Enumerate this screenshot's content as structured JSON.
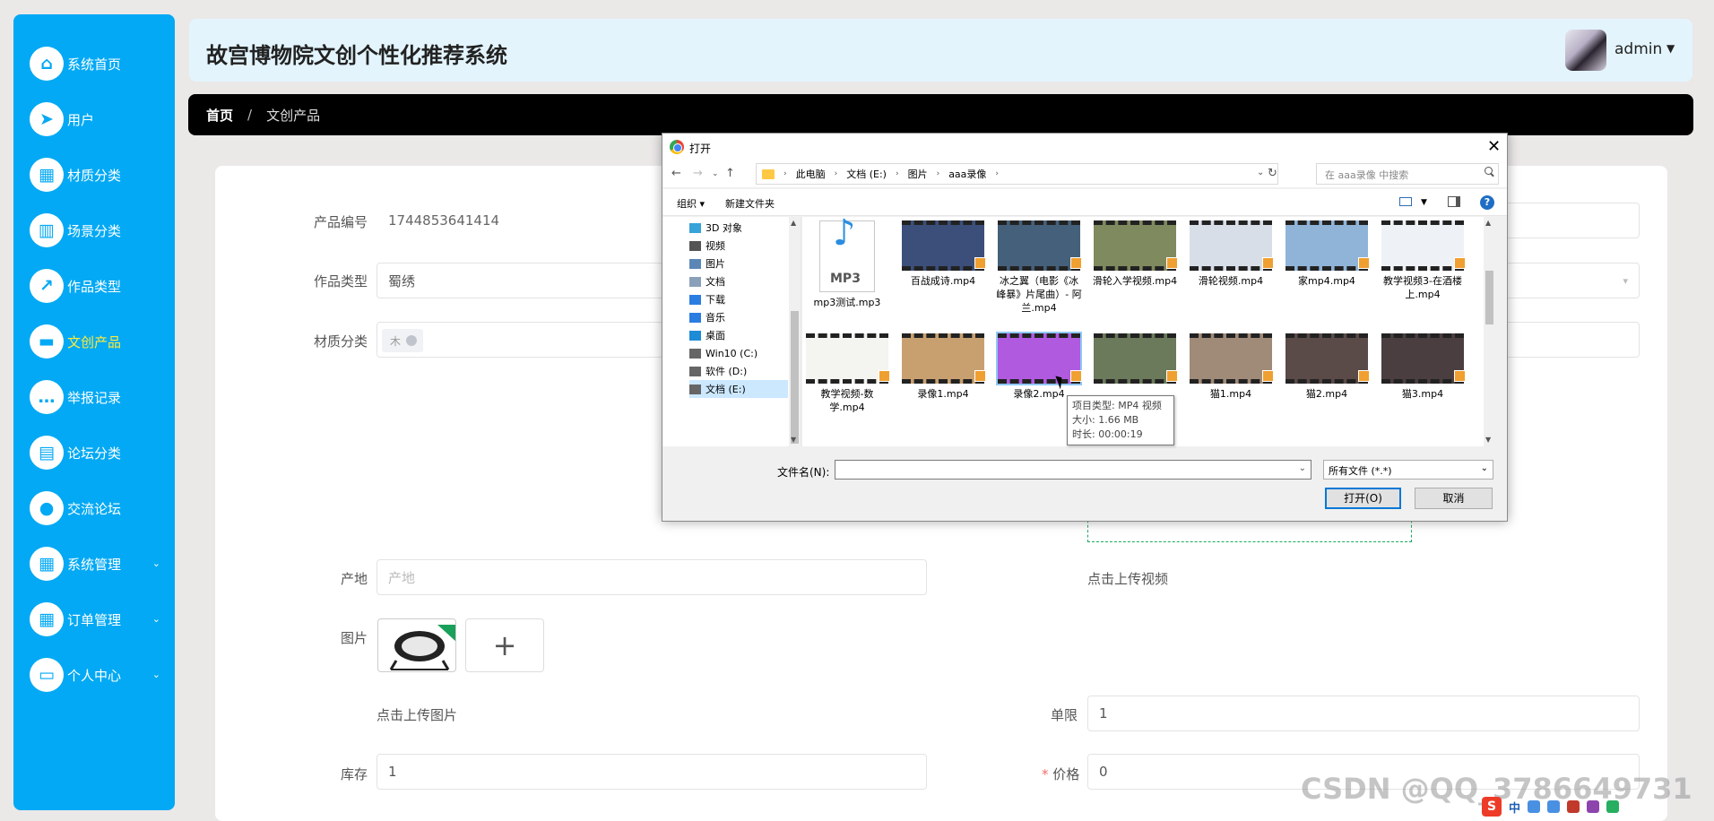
{
  "sidebar": {
    "items": [
      {
        "label": "系统首页",
        "icon": "home-icon",
        "glyph": "⌂",
        "active": false,
        "expandable": false
      },
      {
        "label": "用户",
        "icon": "send-icon",
        "glyph": "➤",
        "active": false,
        "expandable": false
      },
      {
        "label": "材质分类",
        "icon": "grid-icon",
        "glyph": "▦",
        "active": false,
        "expandable": false
      },
      {
        "label": "场景分类",
        "icon": "book-icon",
        "glyph": "▥",
        "active": false,
        "expandable": false
      },
      {
        "label": "作品类型",
        "icon": "chart-icon",
        "glyph": "↗",
        "active": false,
        "expandable": false
      },
      {
        "label": "文创产品",
        "icon": "box-icon",
        "glyph": "▬",
        "active": true,
        "expandable": false
      },
      {
        "label": "举报记录",
        "icon": "message-icon",
        "glyph": "…",
        "active": false,
        "expandable": false
      },
      {
        "label": "论坛分类",
        "icon": "briefcase-icon",
        "glyph": "▤",
        "active": false,
        "expandable": false
      },
      {
        "label": "交流论坛",
        "icon": "pin-icon",
        "glyph": "●",
        "active": false,
        "expandable": false
      },
      {
        "label": "系统管理",
        "icon": "grid-icon",
        "glyph": "▦",
        "active": false,
        "expandable": true
      },
      {
        "label": "订单管理",
        "icon": "grid-icon",
        "glyph": "▦",
        "active": false,
        "expandable": true
      },
      {
        "label": "个人中心",
        "icon": "panel-icon",
        "glyph": "▭",
        "active": false,
        "expandable": true
      }
    ]
  },
  "header": {
    "title": "故宫博物院文创个性化推荐系统",
    "user": "admin"
  },
  "breadcrumb": {
    "home": "首页",
    "sep": "/",
    "current": "文创产品"
  },
  "form": {
    "code_label": "产品编号",
    "code_value": "1744853641414",
    "type_label": "作品类型",
    "type_value": "蜀绣",
    "material_label": "材质分类",
    "material_tag": "木",
    "origin_label": "产地",
    "origin_placeholder": "产地",
    "video_hint": "点击上传视频",
    "image_label": "图片",
    "add_symbol": "+",
    "image_hint": "点击上传图片",
    "limit_label": "单限",
    "limit_value": "1",
    "stock_label": "库存",
    "stock_value": "1",
    "price_req": "*",
    "price_label": "价格",
    "price_value": "0"
  },
  "dialog": {
    "title": "打开",
    "close": "✕",
    "path": [
      "此电脑",
      "文档 (E:)",
      "图片",
      "aaa录像"
    ],
    "search_placeholder": "在 aaa录像 中搜索",
    "toolbar": {
      "organize": "组织 ▾",
      "new_folder": "新建文件夹"
    },
    "tree": [
      {
        "label": "3D 对象",
        "color": "#37a3d8",
        "selected": false
      },
      {
        "label": "视频",
        "color": "#555555",
        "selected": false
      },
      {
        "label": "图片",
        "color": "#5b87b6",
        "selected": false
      },
      {
        "label": "文档",
        "color": "#8aa0b8",
        "selected": false
      },
      {
        "label": "下载",
        "color": "#2b7de0",
        "selected": false
      },
      {
        "label": "音乐",
        "color": "#2b7de0",
        "selected": false
      },
      {
        "label": "桌面",
        "color": "#1e8bd6",
        "selected": false
      },
      {
        "label": "Win10 (C:)",
        "color": "#666666",
        "selected": false
      },
      {
        "label": "软件 (D:)",
        "color": "#666666",
        "selected": false
      },
      {
        "label": "文档 (E:)",
        "color": "#666666",
        "selected": true
      }
    ],
    "files_row1": [
      {
        "name": "mp3测试.mp3",
        "kind": "mp3",
        "color": "#ffffff"
      },
      {
        "name": "百战成诗.mp4",
        "kind": "video",
        "color": "#3b4f7a"
      },
      {
        "name": "冰之翼（电影《冰峰暴》片尾曲）- 阿兰.mp4",
        "kind": "video",
        "color": "#45607a"
      },
      {
        "name": "滑轮入学视频.mp4",
        "kind": "video",
        "color": "#7f8a5e"
      },
      {
        "name": "滑轮视频.mp4",
        "kind": "video",
        "color": "#d8dee8"
      },
      {
        "name": "家mp4.mp4",
        "kind": "video",
        "color": "#8fb4d8"
      },
      {
        "name": "教学视频3-在酒楼上.mp4",
        "kind": "video",
        "color": "#eef1f5"
      }
    ],
    "files_row2": [
      {
        "name": "教学视频-数学.mp4",
        "kind": "video",
        "color": "#f4f4f0"
      },
      {
        "name": "录像1.mp4",
        "kind": "video",
        "color": "#c8a070"
      },
      {
        "name": "录像2.mp4",
        "kind": "video",
        "color": "#b05ae0"
      },
      {
        "name": "",
        "kind": "video",
        "color": "#6a7a5a"
      },
      {
        "name": "猫1.mp4",
        "kind": "video",
        "color": "#a08a78"
      },
      {
        "name": "猫2.mp4",
        "kind": "video",
        "color": "#5a4a48"
      },
      {
        "name": "猫3.mp4",
        "kind": "video",
        "color": "#4a3e40"
      }
    ],
    "mp3_badge": "MP3",
    "mp3_glyph": "♪",
    "tooltip": {
      "type": "项目类型: MP4 视频",
      "size": "大小: 1.66 MB",
      "duration": "时长: 00:00:19"
    },
    "filename_label": "文件名(N):",
    "filetype": "所有文件 (*.*)",
    "open_button": "打开(O)",
    "cancel_button": "取消"
  },
  "watermark": "CSDN @QQ_3786649731",
  "taskbar": {
    "ime": "S",
    "mode": "中"
  }
}
